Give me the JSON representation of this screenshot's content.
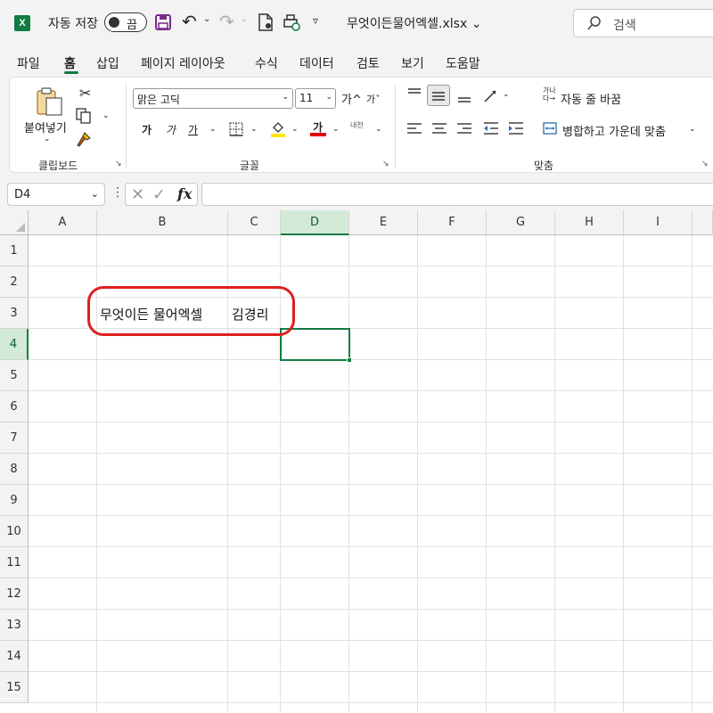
{
  "titlebar": {
    "app_logo": "X",
    "autosave_label": "자동 저장",
    "autosave_state": "끔",
    "qat_more": "▿",
    "filename": "무엇이든물어엑셀.xlsx ⌄",
    "search_placeholder": "검색"
  },
  "menu": {
    "tabs": [
      "파일",
      "홈",
      "삽입",
      "페이지 레이아웃",
      "수식",
      "데이터",
      "검토",
      "보기",
      "도움말"
    ],
    "active_tab": "홈"
  },
  "ribbon": {
    "clipboard": {
      "paste_label": "붙여넣기",
      "group_label": "클립보드"
    },
    "font": {
      "font_name": "맑은 고딕",
      "font_size": "11",
      "grow": "가^",
      "shrink": "가ˇ",
      "bold": "가",
      "italic": "가",
      "underline": "가",
      "font_color_letter": "가",
      "phonetic": "내천",
      "group_label": "글꼴",
      "fill_color": "#ffe600",
      "font_color": "#e00000"
    },
    "alignment": {
      "wrap_icon": "가나\n다→",
      "wrap_label": "자동 줄 바꿈",
      "merge_label": "병합하고 가운데 맞춤",
      "group_label": "맞춤"
    }
  },
  "formula_bar": {
    "name_box": "D4",
    "fx": "fx",
    "formula": ""
  },
  "grid": {
    "columns": [
      "A",
      "B",
      "C",
      "D",
      "E",
      "F",
      "G",
      "H",
      "I"
    ],
    "rows": [
      "1",
      "2",
      "3",
      "4",
      "5",
      "6",
      "7",
      "8",
      "9",
      "10",
      "11",
      "12",
      "13",
      "14",
      "15"
    ],
    "selected_cell": "D4",
    "cells": [
      {
        "ref": "B3",
        "value": "무엇이든 물어엑셀"
      },
      {
        "ref": "C3",
        "value": "김경리"
      }
    ]
  },
  "colors": {
    "accent": "#107c41",
    "annotation": "#e01e1e"
  }
}
